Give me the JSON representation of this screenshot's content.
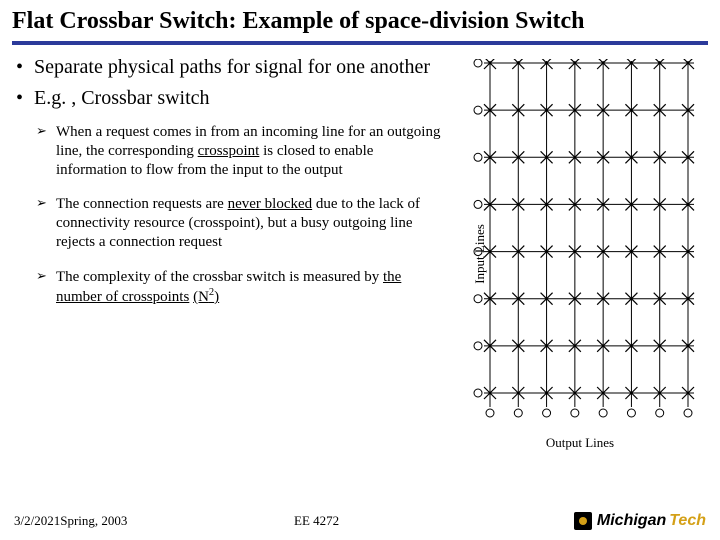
{
  "title": "Flat Crossbar Switch: Example of space-division Switch",
  "bullets": {
    "b1": "Separate physical paths for signal for one another",
    "b2": "E.g. , Crossbar switch"
  },
  "sub": {
    "s1a": "When a request comes in from an incoming line for an outgoing line, the corresponding ",
    "s1_u": "crosspoint",
    "s1b": " is closed to enable information to flow from the input to the output",
    "s2a": "The connection requests are ",
    "s2_u": "never blocked",
    "s2b": " due to the lack of connectivity resource (crosspoint), but a busy outgoing line rejects a connection request",
    "s3a": "The complexity of the crossbar switch is measured by ",
    "s3_u1": "the number of crosspoints",
    "s3_u2_open": "(N",
    "s3_u2_sup": "2",
    "s3_u2_close": ")"
  },
  "diagram": {
    "input_label": "Input Lines",
    "output_label": "Output Lines",
    "rows": 8,
    "cols": 8
  },
  "footer": {
    "date": "3/2/2021",
    "semester": "Spring, 2003",
    "course": "EE 4272"
  },
  "logo": {
    "part1": "Michigan",
    "part2": "Tech"
  }
}
